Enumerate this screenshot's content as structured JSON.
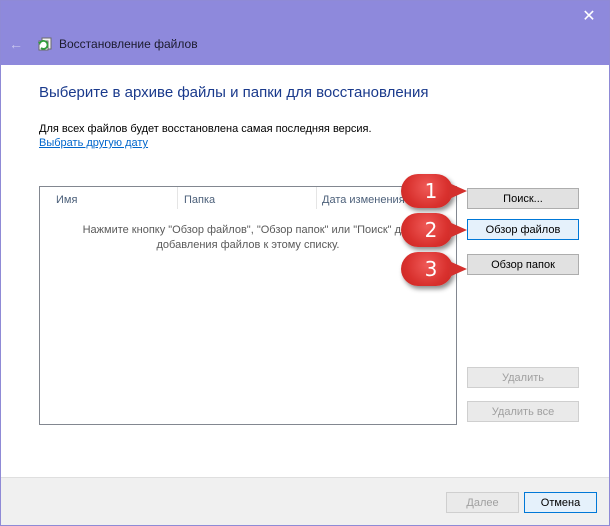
{
  "window": {
    "title": "Восстановление файлов",
    "close_glyph": "✕",
    "back_glyph": "←"
  },
  "main": {
    "heading": "Выберите в архиве файлы и папки для восстановления",
    "subtitle": "Для всех файлов будет восстановлена самая последняя версия.",
    "link": "Выбрать другую дату"
  },
  "list": {
    "columns": [
      "Имя",
      "Папка",
      "Дата изменения"
    ],
    "empty_line1": "Нажмите кнопку \"Обзор файлов\", \"Обзор папок\" или \"Поиск\" для",
    "empty_line2": "добавления файлов к этому списку."
  },
  "side_buttons": {
    "search": "Поиск...",
    "browse_files": "Обзор файлов",
    "browse_folders": "Обзор папок",
    "remove": "Удалить",
    "remove_all": "Удалить все"
  },
  "footer": {
    "next": "Далее",
    "cancel": "Отмена"
  },
  "annotations": {
    "badge1": "1",
    "badge2": "2",
    "badge3": "3"
  },
  "colors": {
    "titlebar": "#8e89dc",
    "heading": "#1a3a8c",
    "link": "#0066cc",
    "badge": "#d9312e"
  }
}
